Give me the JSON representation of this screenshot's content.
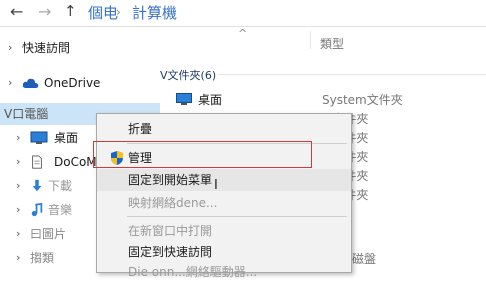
{
  "address_bar": {
    "back_icon": "back-arrow-icon",
    "forward_icon": "forward-arrow-icon",
    "up_icon": "up-arrow-icon",
    "breadcrumb": [
      "個电",
      "計算機"
    ]
  },
  "nav_pane": {
    "items": [
      {
        "label": "快速訪問",
        "icon": "star-icon"
      },
      {
        "label": "OneDrive",
        "icon": "cloud-icon"
      },
      {
        "label": "V口電腦",
        "icon": "computer-icon"
      },
      {
        "label": "桌面",
        "icon": "desktop-icon"
      },
      {
        "label": "DoCoMe",
        "icon": "document-icon"
      },
      {
        "label": "下載",
        "icon": "download-icon"
      },
      {
        "label": "音樂",
        "icon": "music-icon"
      },
      {
        "label": "曰圖片",
        "icon": "pictures-icon"
      },
      {
        "label": "搊類",
        "icon": "video-icon"
      }
    ]
  },
  "content": {
    "column_type": "類型",
    "group_label": "V文件夾(6)",
    "rows": [
      {
        "name": "桌面",
        "type": "System文件夾"
      },
      {
        "name": "",
        "type": "M文件夾"
      },
      {
        "name": "",
        "type": "M文件夾"
      },
      {
        "name": "",
        "type": "M文件夾"
      },
      {
        "name": "",
        "type": "M文件夾"
      },
      {
        "name": "",
        "type": "M文件夾"
      }
    ],
    "ghost_bottom": "磁盤"
  },
  "context_menu": {
    "items": [
      {
        "label": "折疊",
        "disabled": false
      },
      {
        "label": "管理",
        "disabled": false,
        "icon": "shield-icon"
      },
      {
        "label": "固定到開始菜單",
        "disabled": false
      },
      {
        "label": "映射網絡dene...",
        "disabled": true
      },
      {
        "label": "在新窗口中打開",
        "disabled": true
      },
      {
        "label": "固定到快速訪問",
        "disabled": false
      },
      {
        "label": "Die onn...網絡驅動器...",
        "disabled": true
      }
    ]
  }
}
